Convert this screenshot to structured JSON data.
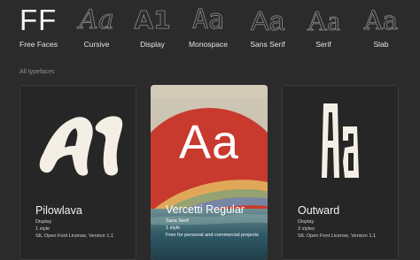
{
  "nav": {
    "logo": {
      "mark": "FF",
      "label": "Free Faces"
    },
    "categories": [
      {
        "label": "Cursive",
        "sample": "Aa"
      },
      {
        "label": "Display",
        "sample": "A1"
      },
      {
        "label": "Monospace",
        "sample": "Aa"
      },
      {
        "label": "Sans Serif",
        "sample": "Aa"
      },
      {
        "label": "Serif",
        "sample": "Aa"
      },
      {
        "label": "Slab",
        "sample": "Aa"
      }
    ]
  },
  "section": {
    "title": "All typefaces"
  },
  "cards": [
    {
      "name": "Pilowlava",
      "sample": "A1",
      "category": "Display",
      "styles": "1 style",
      "license": "SIL Open Font License, Version 1.1"
    },
    {
      "name": "Vercetti Regular",
      "sample": "Aa",
      "category": "Sans Serif",
      "styles": "1 style",
      "license": "Free for personal and commercial projects"
    },
    {
      "name": "Outward",
      "sample": "Aa",
      "category": "Display",
      "styles": "3 styles",
      "license": "SIL Open Font License, Version 1.1"
    }
  ],
  "colors": {
    "background": "#2b2b2b",
    "card_background": "#262626",
    "text": "#ededed",
    "muted_text": "#8f8f8f",
    "sun_red": "#c93a2e"
  }
}
